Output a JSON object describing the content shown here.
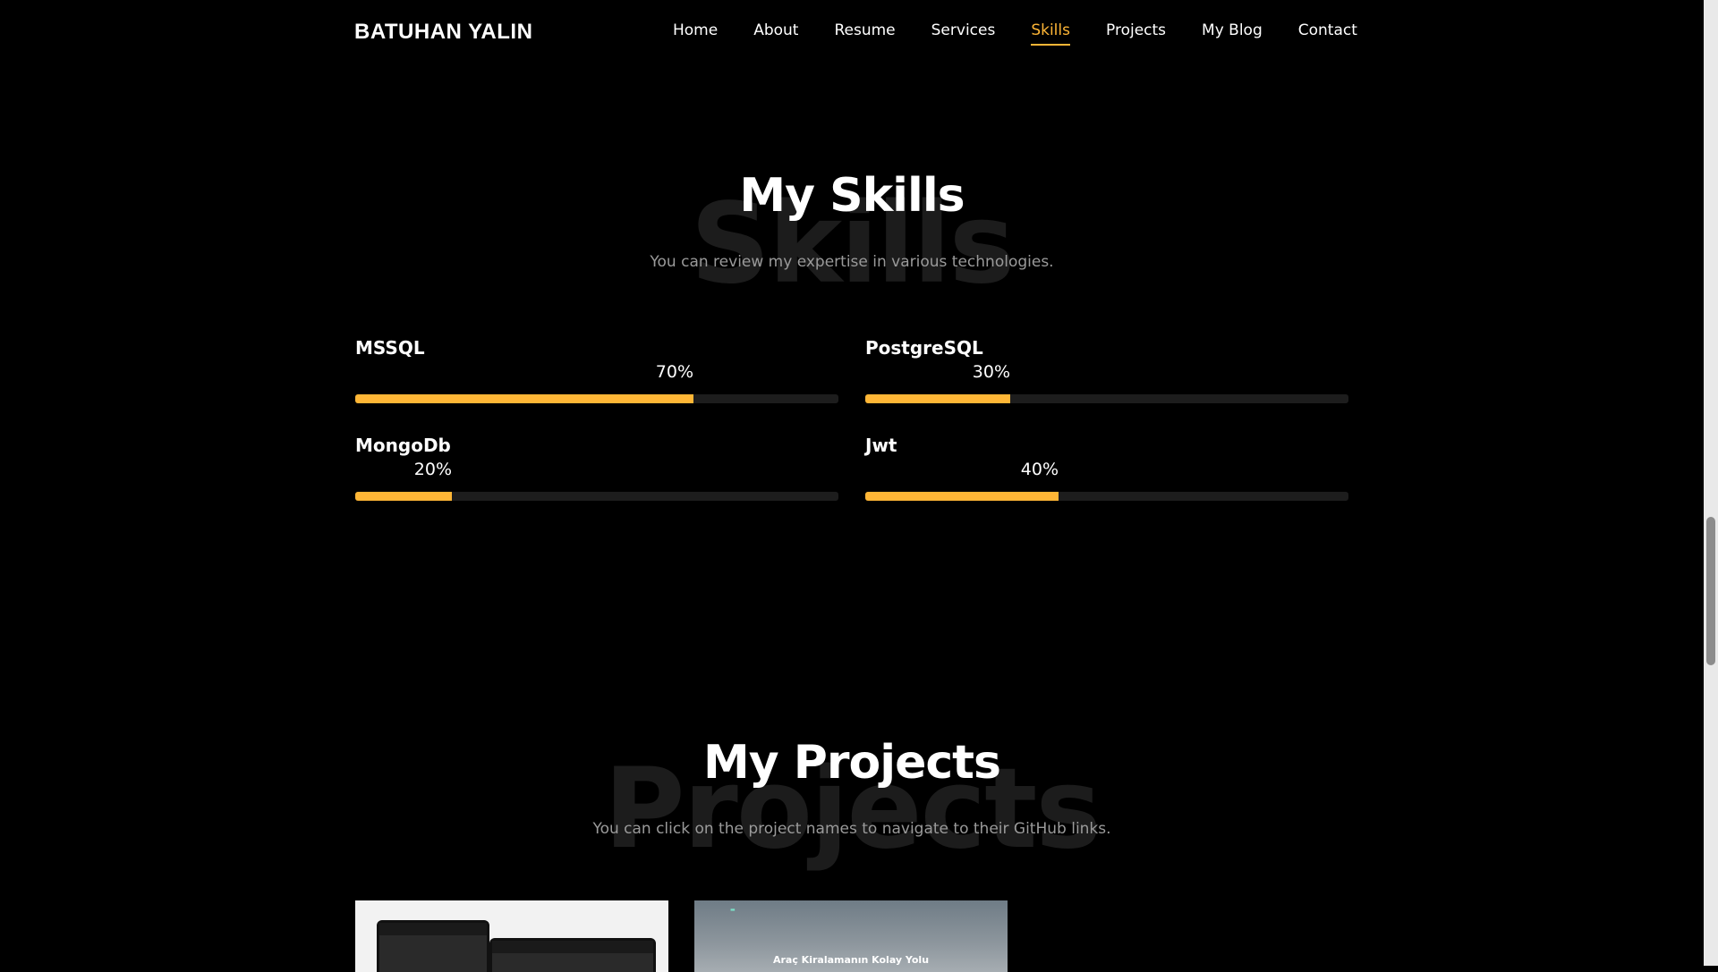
{
  "header": {
    "logo": "BATUHAN YALIN",
    "nav": [
      "Home",
      "About",
      "Resume",
      "Services",
      "Skills",
      "Projects",
      "My Blog",
      "Contact"
    ],
    "active": "Skills"
  },
  "skills_section": {
    "bg_word": "Skills",
    "title": "My Skills",
    "subtitle": "You can review my expertise in various technologies.",
    "skills": [
      {
        "name": "MSSQL",
        "percent_label": "70%",
        "percent": 70
      },
      {
        "name": "PostgreSQL",
        "percent_label": "30%",
        "percent": 30
      },
      {
        "name": "MongoDb",
        "percent_label": "20%",
        "percent": 20
      },
      {
        "name": "Jwt",
        "percent_label": "40%",
        "percent": 40
      }
    ]
  },
  "projects_section": {
    "bg_word": "Projects",
    "title": "My Projects",
    "subtitle": "You can click on the project names to navigate to their GitHub links.",
    "card2_title": "Araç Kiralamanın Kolay Yolu"
  },
  "colors": {
    "accent": "#ffb636",
    "background": "#000000"
  }
}
